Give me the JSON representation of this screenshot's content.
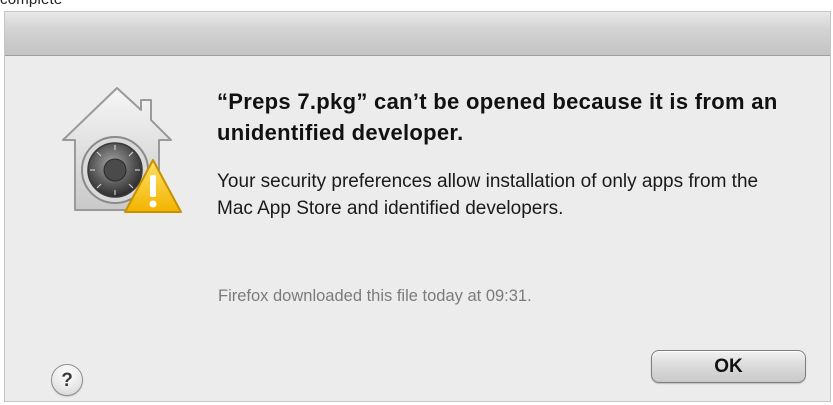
{
  "fragment_text": "complete",
  "dialog": {
    "icon": "gatekeeper-house-vault-warning-icon",
    "headline": "“Preps 7.pkg” can’t be opened because it is from an unidentified developer.",
    "message": "Your security preferences allow installation of only apps from the Mac App Store and identified developers.",
    "source_note": "Firefox downloaded this file today at 09:31.",
    "help_label": "?",
    "ok_label": "OK"
  },
  "colors": {
    "dialog_bg": "#ececec",
    "warning_yellow": "#f7c21a",
    "note_gray": "#7b7b7b"
  }
}
